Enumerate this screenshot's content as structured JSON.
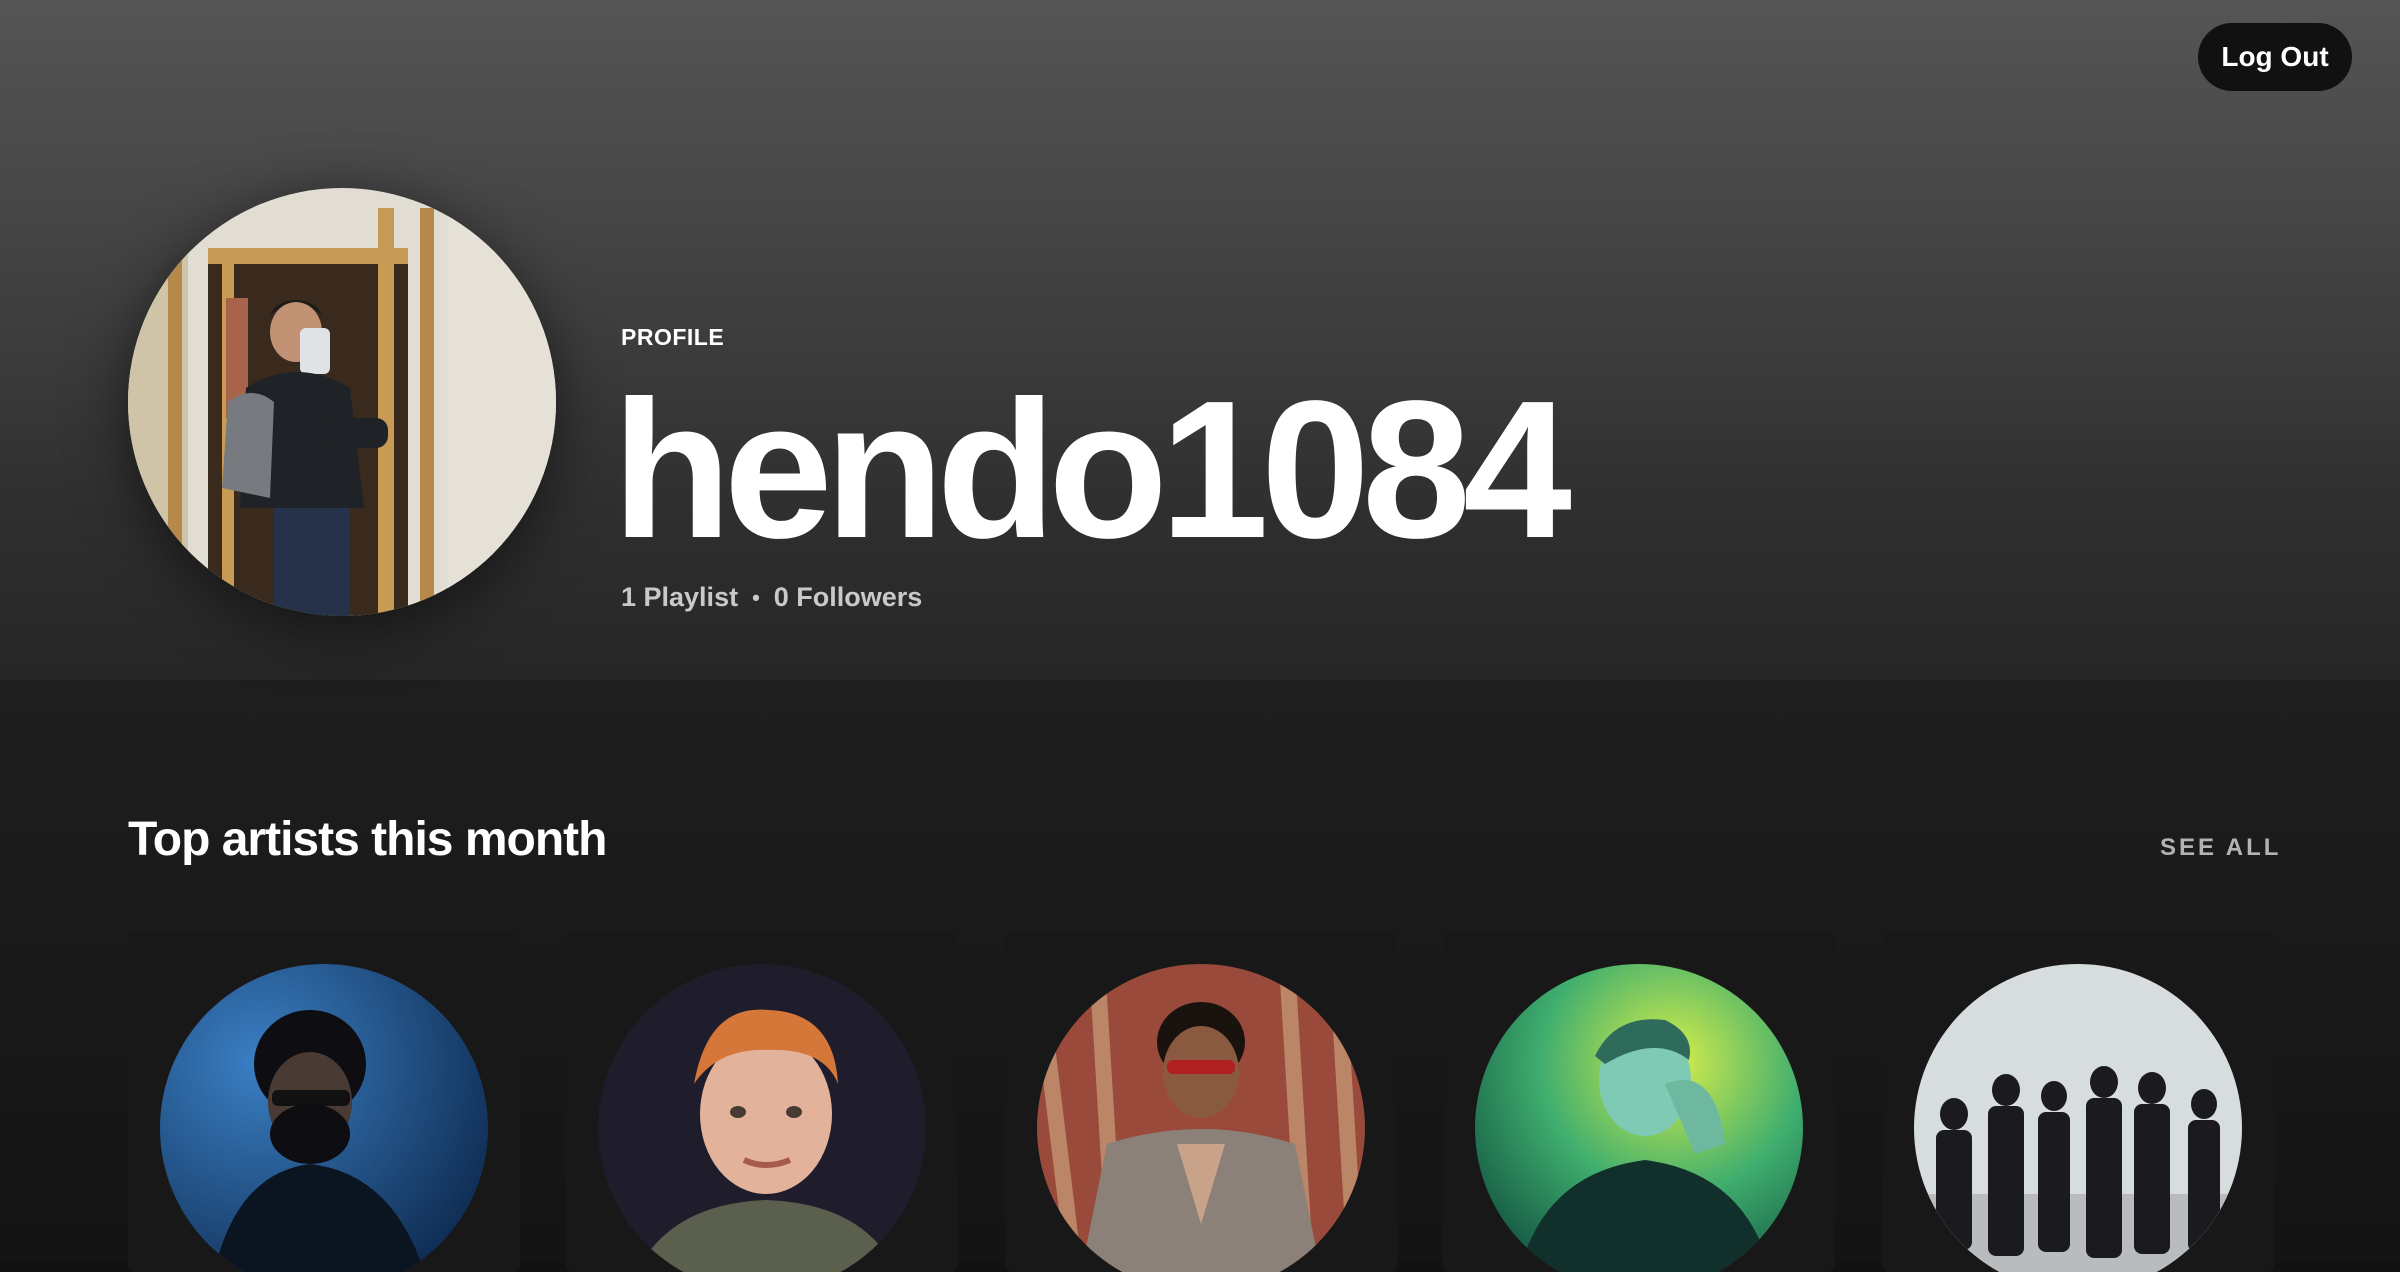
{
  "header": {
    "kicker": "PROFILE",
    "username": "hendo1084",
    "playlists": "1 Playlist",
    "separator": "•",
    "followers": "0 Followers",
    "logout_label": "Log Out"
  },
  "top_artists": {
    "title": "Top artists this month",
    "see_all": "SEE ALL",
    "items": [
      {
        "image": "artist-photo-1",
        "bg": "#1b4f86"
      },
      {
        "image": "artist-photo-2",
        "bg": "#1f1c2c"
      },
      {
        "image": "artist-photo-3",
        "bg": "#9a4a3a"
      },
      {
        "image": "artist-photo-4",
        "bg": "#2f9a6c"
      },
      {
        "image": "artist-photo-5",
        "bg": "#d7dcdf"
      }
    ]
  },
  "colors": {
    "background": "#121212",
    "card": "#181818",
    "text": "#ffffff",
    "muted": "#b3b3b3"
  }
}
